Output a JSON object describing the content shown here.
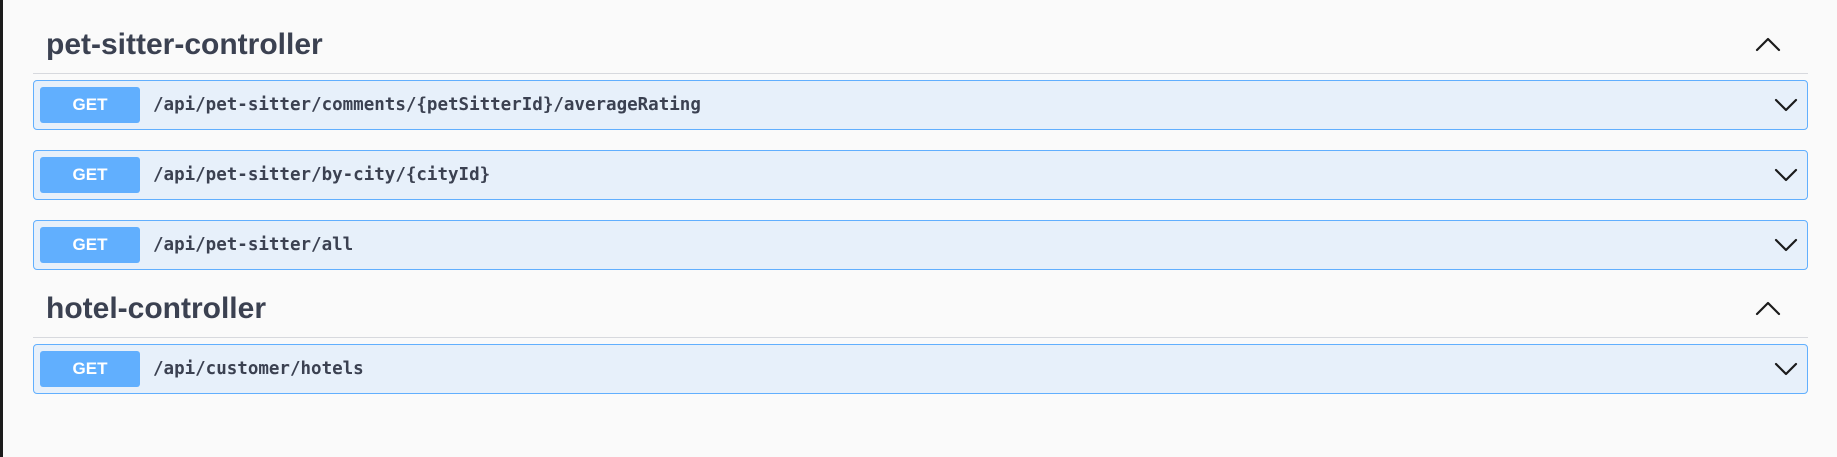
{
  "sections": [
    {
      "title": "pet-sitter-controller",
      "collapse_icon": "chevron-up-icon",
      "operations": [
        {
          "method": "GET",
          "path": "/api/pet-sitter/comments/{petSitterId}/averageRating",
          "icon": "chevron-down-icon"
        },
        {
          "method": "GET",
          "path": "/api/pet-sitter/by-city/{cityId}",
          "icon": "chevron-down-icon"
        },
        {
          "method": "GET",
          "path": "/api/pet-sitter/all",
          "icon": "chevron-down-icon"
        }
      ]
    },
    {
      "title": "hotel-controller",
      "collapse_icon": "chevron-up-icon",
      "operations": [
        {
          "method": "GET",
          "path": "/api/customer/hotels",
          "icon": "chevron-down-icon"
        }
      ]
    }
  ],
  "colors": {
    "get_method": "#61affe",
    "get_background": "#ebf3fb",
    "title_text": "#3b4151",
    "page_background": "#fafafa"
  }
}
